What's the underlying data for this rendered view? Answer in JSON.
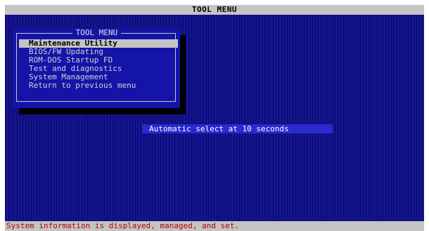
{
  "window": {
    "title": "TOOL MENU"
  },
  "menu": {
    "title": "TOOL MENU",
    "items": [
      {
        "label": "Maintenance Utility",
        "selected": true
      },
      {
        "label": "BIOS/FW Updating",
        "selected": false
      },
      {
        "label": "ROM-DOS Startup FD",
        "selected": false
      },
      {
        "label": "Test and diagnostics",
        "selected": false
      },
      {
        "label": "System Management",
        "selected": false
      },
      {
        "label": "Return to previous menu",
        "selected": false
      }
    ]
  },
  "auto_select": {
    "text": "Automatic select at 10 seconds"
  },
  "status_bar": {
    "text": "System information is displayed, managed, and set."
  },
  "colors": {
    "screen_background": "#0e0e80",
    "menu_background": "#1414a8",
    "highlight": "#c4c4c4",
    "status_text": "#b00000"
  }
}
